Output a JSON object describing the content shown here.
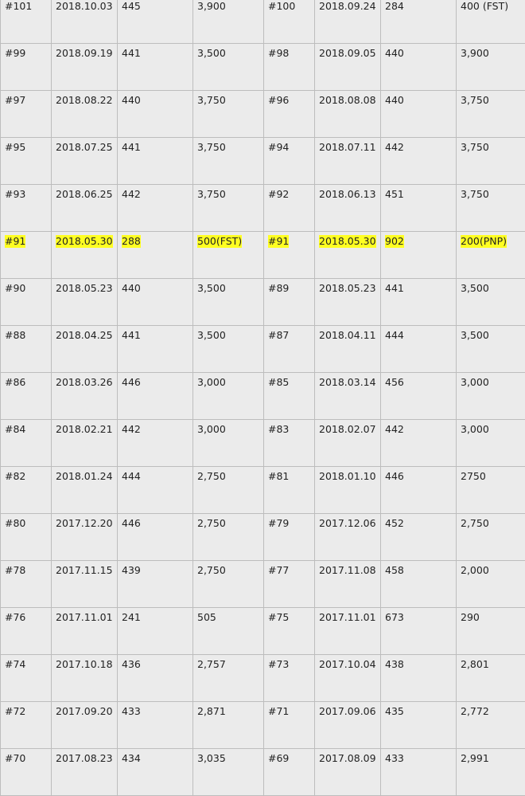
{
  "rows": [
    {
      "highlight": false,
      "cells": [
        "#101",
        "2018.10.03",
        "445",
        "3,900",
        "#100",
        "2018.09.24",
        "284",
        "400 (FST)"
      ]
    },
    {
      "highlight": false,
      "cells": [
        "#99",
        "2018.09.19",
        "441",
        "3,500",
        "#98",
        "2018.09.05",
        "440",
        "3,900"
      ]
    },
    {
      "highlight": false,
      "cells": [
        "#97",
        "2018.08.22",
        "440",
        "3,750",
        "#96",
        "2018.08.08",
        "440",
        "3,750"
      ]
    },
    {
      "highlight": false,
      "cells": [
        "#95",
        "2018.07.25",
        "441",
        "3,750",
        "#94",
        "2018.07.11",
        "442",
        "3,750"
      ]
    },
    {
      "highlight": false,
      "cells": [
        "#93",
        "2018.06.25",
        "442",
        "3,750",
        "#92",
        "2018.06.13",
        "451",
        "3,750"
      ]
    },
    {
      "highlight": true,
      "cells": [
        "#91",
        "2018.05.30",
        "288",
        "500(FST)",
        "#91",
        "2018.05.30",
        "902",
        "200(PNP)"
      ]
    },
    {
      "highlight": false,
      "cells": [
        "#90",
        "2018.05.23",
        "440",
        "3,500",
        "#89",
        "2018.05.23",
        "441",
        "3,500"
      ]
    },
    {
      "highlight": false,
      "cells": [
        "#88",
        "2018.04.25",
        "441",
        "3,500",
        "#87",
        "2018.04.11",
        "444",
        "3,500"
      ]
    },
    {
      "highlight": false,
      "cells": [
        "#86",
        "2018.03.26",
        "446",
        "3,000",
        "#85",
        "2018.03.14",
        "456",
        "3,000"
      ]
    },
    {
      "highlight": false,
      "cells": [
        "#84",
        "2018.02.21",
        "442",
        "3,000",
        "#83",
        "2018.02.07",
        "442",
        "3,000"
      ]
    },
    {
      "highlight": false,
      "cells": [
        "#82",
        "2018.01.24",
        "444",
        "2,750",
        "#81",
        "2018.01.10",
        "446",
        "2750"
      ]
    },
    {
      "highlight": false,
      "cells": [
        "#80",
        "2017.12.20",
        "446",
        "2,750",
        "#79",
        "2017.12.06",
        "452",
        "2,750"
      ]
    },
    {
      "highlight": false,
      "cells": [
        "#78",
        "2017.11.15",
        "439",
        "2,750",
        "#77",
        "2017.11.08",
        "458",
        "2,000"
      ]
    },
    {
      "highlight": false,
      "cells": [
        "#76",
        "2017.11.01",
        "241",
        "505",
        "#75",
        "2017.11.01",
        "673",
        "290"
      ]
    },
    {
      "highlight": false,
      "cells": [
        "#74",
        "2017.10.18",
        "436",
        "2,757",
        "#73",
        "2017.10.04",
        "438",
        "2,801"
      ]
    },
    {
      "highlight": false,
      "cells": [
        "#72",
        "2017.09.20",
        "433",
        "2,871",
        "#71",
        "2017.09.06",
        "435",
        "2,772"
      ]
    },
    {
      "highlight": false,
      "cells": [
        "#70",
        "2017.08.23",
        "434",
        "3,035",
        "#69",
        "2017.08.09",
        "433",
        "2,991"
      ]
    }
  ],
  "colors": {
    "highlight": "#ffff22",
    "background": "#ebebeb",
    "grid": "#bdbdbd"
  }
}
